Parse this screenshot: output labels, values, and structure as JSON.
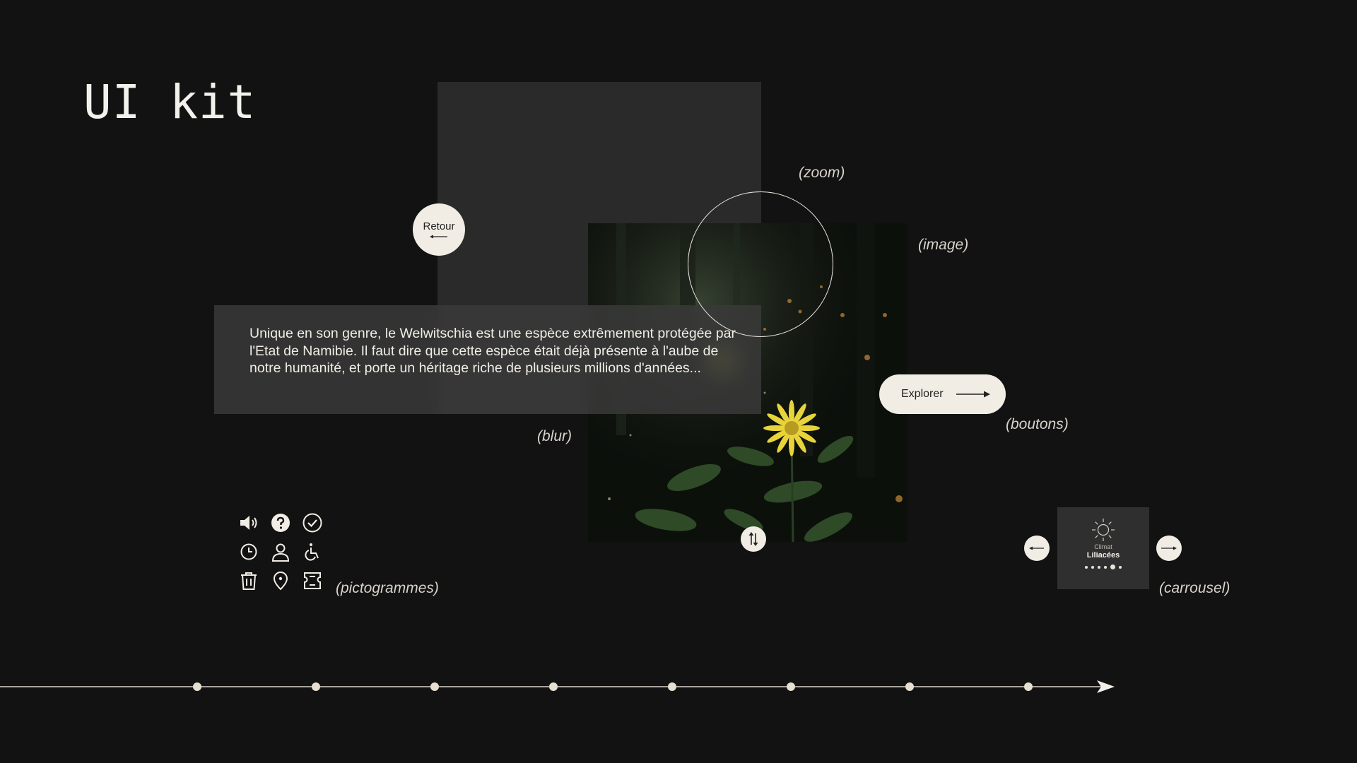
{
  "page": {
    "title": "UI kit"
  },
  "labels": {
    "zoom": "(zoom)",
    "image": "(image)",
    "boutons": "(boutons)",
    "blur": "(blur)",
    "pictogrammes": "(pictogrammes)",
    "carrousel": "(carrousel)"
  },
  "blur_panel": {
    "text": "Unique en son genre, le Welwitschia est une espèce extrêmement protégée par l'Etat de Namibie. Il faut dire que cette espèce était déjà présente à l'aube de notre humanité, et porte un héritage riche de plusieurs millions d'années..."
  },
  "buttons": {
    "retour_label": "Retour",
    "explorer_label": "Explorer"
  },
  "pictograms": [
    "speaker-icon",
    "help-icon",
    "check-circle-icon",
    "clock-icon",
    "user-icon",
    "wheelchair-icon",
    "trash-icon",
    "location-pin-icon",
    "ticket-icon"
  ],
  "carousel": {
    "card_label": "Climat",
    "card_value": "Liliacées",
    "dot_count": 6,
    "active_dot": 4
  },
  "timeline": {
    "point_count": 8
  },
  "colors": {
    "background": "#121212",
    "panel": "#2a2a2a",
    "button": "#f1ede4",
    "text": "#ece7de"
  }
}
